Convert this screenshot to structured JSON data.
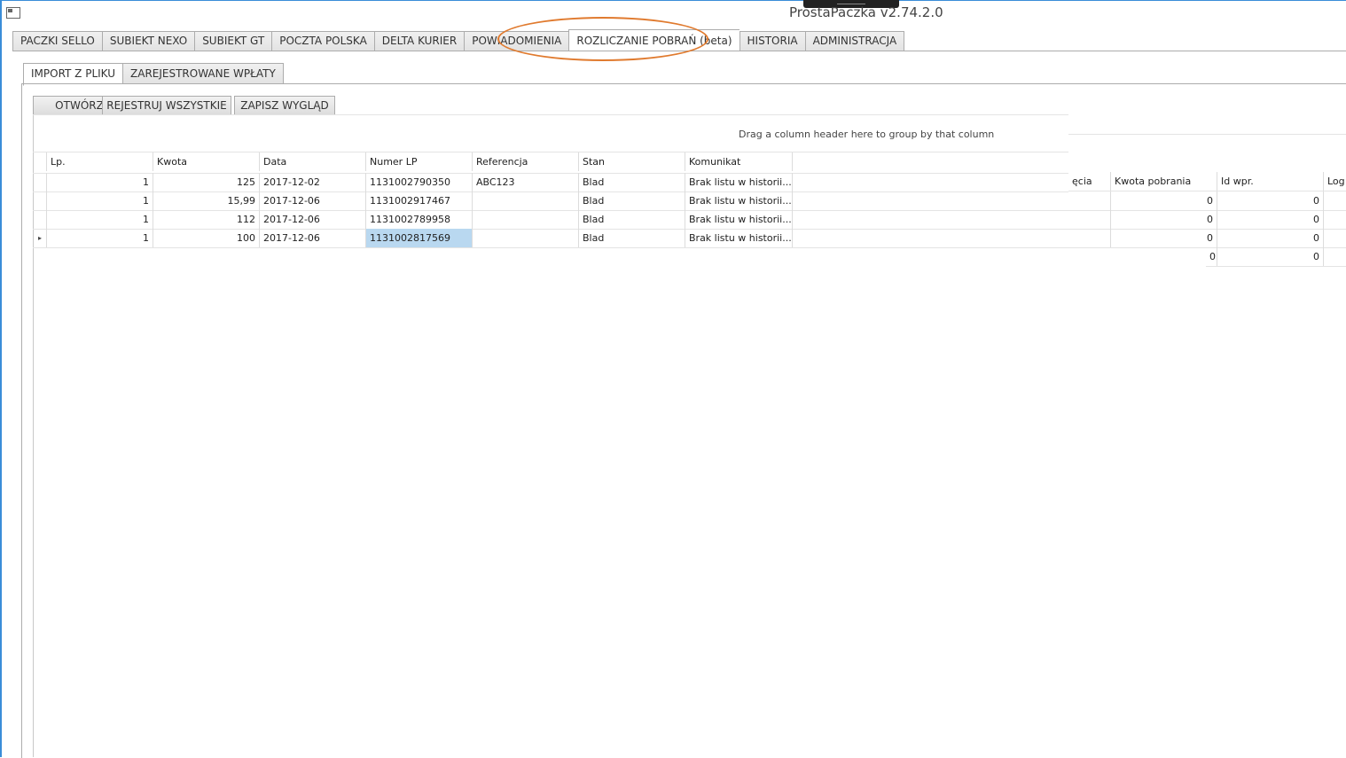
{
  "window": {
    "title": "ProstaPaczka v2.74.2.0"
  },
  "tabs": [
    {
      "label": "PACZKI SELLO"
    },
    {
      "label": "SUBIEKT NEXO"
    },
    {
      "label": "SUBIEKT GT"
    },
    {
      "label": "POCZTA POLSKA"
    },
    {
      "label": "DELTA KURIER"
    },
    {
      "label": "POWIADOMIENIA"
    },
    {
      "label": "ROZLICZANIE POBRAŃ (beta)"
    },
    {
      "label": "HISTORIA"
    },
    {
      "label": "ADMINISTRACJA"
    }
  ],
  "subtabs": [
    {
      "label": "IMPORT Z PLIKU"
    },
    {
      "label": "ZAREJESTROWANE WPŁATY"
    }
  ],
  "toolbar": {
    "open_label": "OTWÓRZ",
    "register_all_label": "REJESTRUJ WSZYSTKIE",
    "save_layout_label": "ZAPISZ WYGLĄD"
  },
  "grid": {
    "group_hint": "Drag a column header here to group by that column",
    "columns": [
      "Lp.",
      "Kwota",
      "Data",
      "Numer LP",
      "Referencja",
      "Stan",
      "Komunikat"
    ],
    "rows": [
      {
        "lp": "1",
        "kwota": "125",
        "data": "2017-12-02",
        "numer": "1131002790350",
        "ref": "ABC123",
        "stan": "Blad",
        "komunikat": "Brak listu w historii..."
      },
      {
        "lp": "1",
        "kwota": "15,99",
        "data": "2017-12-06",
        "numer": "1131002917467",
        "ref": "",
        "stan": "Blad",
        "komunikat": "Brak listu w historii..."
      },
      {
        "lp": "1",
        "kwota": "112",
        "data": "2017-12-06",
        "numer": "1131002789958",
        "ref": "",
        "stan": "Blad",
        "komunikat": "Brak listu w historii..."
      },
      {
        "lp": "1",
        "kwota": "100",
        "data": "2017-12-06",
        "numer": "1131002817569",
        "ref": "",
        "stan": "Blad",
        "komunikat": "Brak listu w historii..."
      }
    ]
  },
  "right_grid": {
    "columns": [
      "ęcia",
      "Kwota pobrania",
      "Id wpr.",
      "Log"
    ],
    "rows": [
      {
        "kwota": "0",
        "id": "0"
      },
      {
        "kwota": "0",
        "id": "0"
      },
      {
        "kwota": "0",
        "id": "0"
      },
      {
        "kwota": "0",
        "id": "0"
      }
    ]
  },
  "colors": {
    "highlight": "#e07a2e",
    "selection": "#b9d8f0",
    "window_border": "#3a8dd8"
  }
}
